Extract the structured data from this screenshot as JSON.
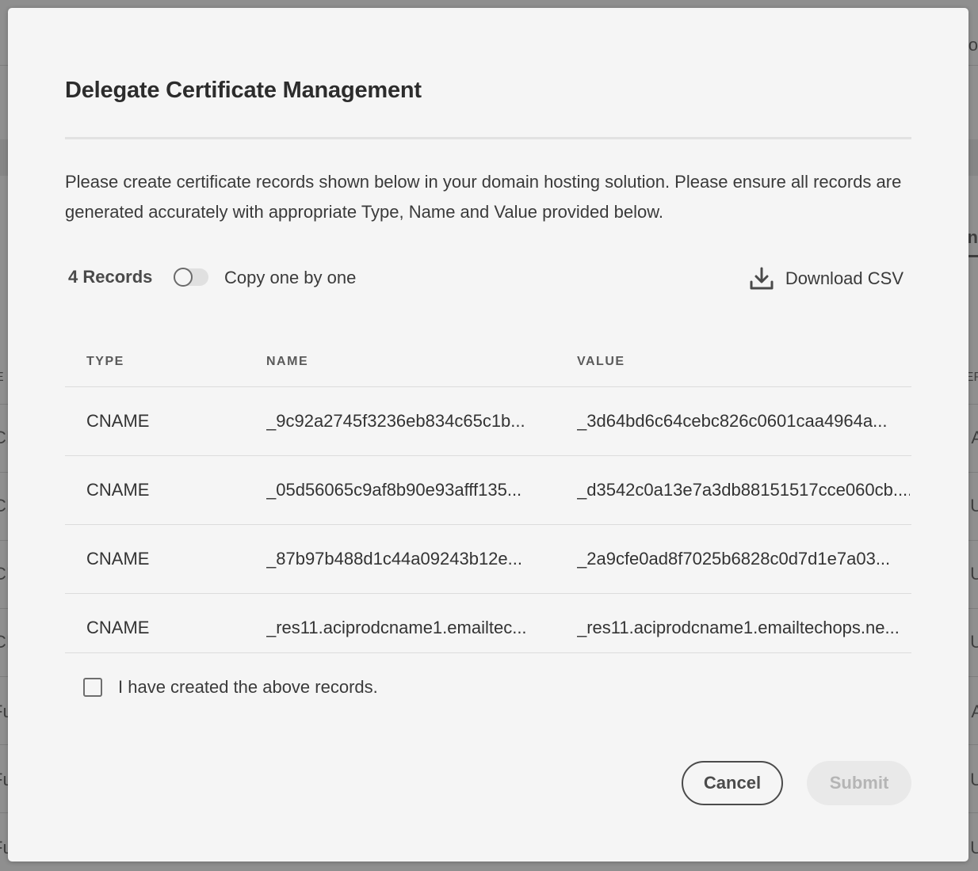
{
  "modal": {
    "title": "Delegate Certificate Management",
    "description": "Please create certificate records shown below in your domain hosting solution. Please ensure all records are generated accurately with appropriate Type, Name and Value provided below."
  },
  "toolbar": {
    "records_count": "4 Records",
    "copy_toggle_label": "Copy one by one",
    "copy_toggle_on": false,
    "download_label": "Download CSV",
    "download_icon": "download-icon"
  },
  "table": {
    "columns": [
      "TYPE",
      "NAME",
      "VALUE"
    ],
    "rows": [
      {
        "type": "CNAME",
        "name": "_9c92a2745f3236eb834c65c1b...",
        "value": "_3d64bd6c64cebc826c0601caa4964a..."
      },
      {
        "type": "CNAME",
        "name": "_05d56065c9af8b90e93afff135...",
        "value": "_d3542c0a13e7a3db88151517cce060cb...."
      },
      {
        "type": "CNAME",
        "name": "_87b97b488d1c44a09243b12e...",
        "value": "_2a9cfe0ad8f7025b6828c0d7d1e7a03..."
      },
      {
        "type": "CNAME",
        "name": "_res11.aciprodcname1.emailtec...",
        "value": "_res11.aciprodcname1.emailtechops.ne..."
      }
    ]
  },
  "confirm": {
    "label": "I have created the above records.",
    "checked": false
  },
  "actions": {
    "cancel_label": "Cancel",
    "submit_label": "Submit",
    "submit_disabled": true
  },
  "background": {
    "edge_text": [
      "o",
      "n",
      "E",
      "ER",
      "CI",
      "A",
      "CI",
      "U",
      "CI",
      "U",
      "CI",
      "U",
      "Fu",
      "A",
      "Fu",
      "U",
      "Fu",
      "U"
    ]
  }
}
